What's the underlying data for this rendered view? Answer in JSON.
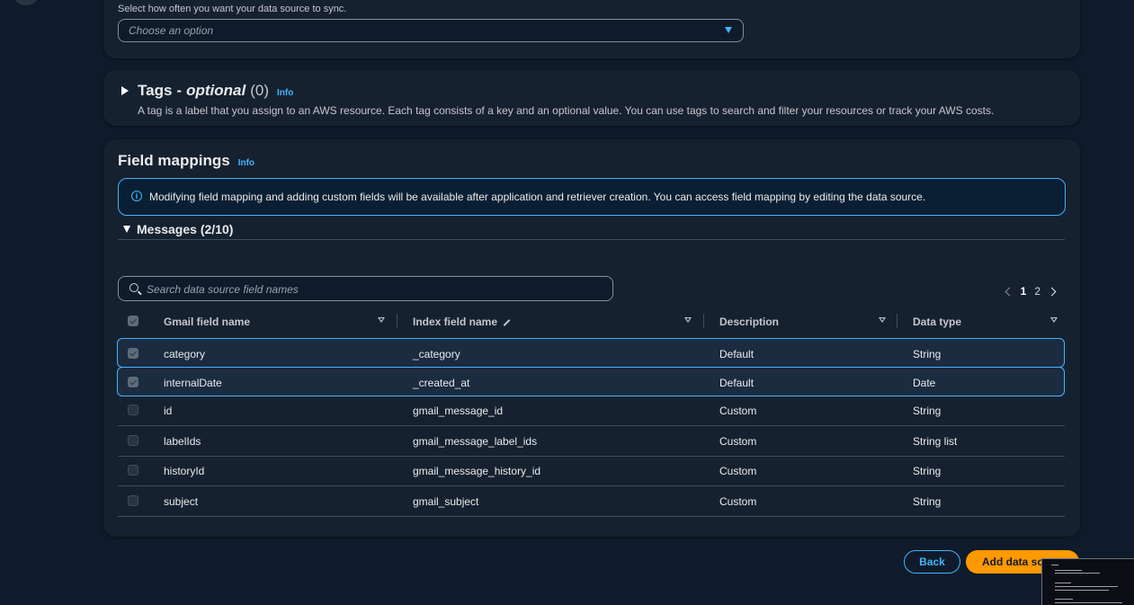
{
  "sync": {
    "description": "Select how often you want your data source to sync.",
    "placeholder": "Choose an option"
  },
  "tags": {
    "title": "Tags",
    "dash": "-",
    "optional": "optional",
    "count": "(0)",
    "info": "Info",
    "description": "A tag is a label that you assign to an AWS resource. Each tag consists of a key and an optional value. You can use tags to search and filter your resources or track your AWS costs."
  },
  "field_mappings": {
    "title": "Field mappings",
    "info": "Info",
    "alert": "Modifying field mapping and adding custom fields will be available after application and retriever creation. You can access field mapping by editing the data source.",
    "section_title": "Messages (2/10)",
    "search_placeholder": "Search data source field names",
    "pages": [
      "1",
      "2"
    ],
    "columns": [
      "Gmail field name",
      "Index field name",
      "Description",
      "Data type"
    ],
    "rows": [
      {
        "gmail": "category",
        "index": "_category",
        "description": "Default",
        "type": "String",
        "selected": true
      },
      {
        "gmail": "internalDate",
        "index": "_created_at",
        "description": "Default",
        "type": "Date",
        "selected": true
      },
      {
        "gmail": "id",
        "index": "gmail_message_id",
        "description": "Custom",
        "type": "String",
        "selected": false
      },
      {
        "gmail": "labelIds",
        "index": "gmail_message_label_ids",
        "description": "Custom",
        "type": "String list",
        "selected": false
      },
      {
        "gmail": "historyId",
        "index": "gmail_message_history_id",
        "description": "Custom",
        "type": "String",
        "selected": false
      },
      {
        "gmail": "subject",
        "index": "gmail_subject",
        "description": "Custom",
        "type": "String",
        "selected": false
      }
    ]
  },
  "footer": {
    "back": "Back",
    "add": "Add data so"
  },
  "colors": {
    "background": "#0f1b2a",
    "panel": "#16212f",
    "accent": "#42b4ff",
    "primary_button": "#ff9900"
  }
}
